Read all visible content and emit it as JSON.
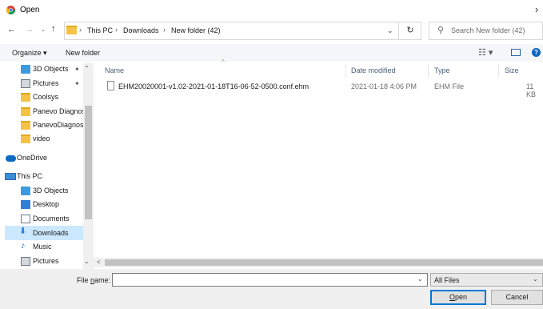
{
  "window": {
    "title": "Open"
  },
  "address": {
    "crumbs": [
      "This PC",
      "Downloads",
      "New folder (42)"
    ],
    "separator": "›",
    "search_placeholder": "Search New folder (42)"
  },
  "toolbar": {
    "organize_label": "Organize ▾",
    "new_folder_label": "New folder"
  },
  "nav": {
    "quick_access": [
      {
        "label": "3D Objects",
        "icon": "cube-icon",
        "pinned": true
      },
      {
        "label": "Pictures",
        "icon": "pictures-icon",
        "pinned": true
      },
      {
        "label": "Coolsys",
        "icon": "folder-icon"
      },
      {
        "label": "Panevo Diagnos",
        "icon": "folder-icon"
      },
      {
        "label": "PanevoDiagnost",
        "icon": "folder-icon"
      },
      {
        "label": "video",
        "icon": "folder-icon"
      }
    ],
    "onedrive": "OneDrive",
    "this_pc": "This PC",
    "pc_items": [
      {
        "label": "3D Objects",
        "icon": "cube-icon"
      },
      {
        "label": "Desktop",
        "icon": "desktop-icon"
      },
      {
        "label": "Documents",
        "icon": "documents-icon"
      },
      {
        "label": "Downloads",
        "icon": "downloads-icon",
        "selected": true
      },
      {
        "label": "Music",
        "icon": "music-icon"
      },
      {
        "label": "Pictures",
        "icon": "pictures-icon"
      }
    ]
  },
  "columns": {
    "name": "Name",
    "date": "Date modified",
    "type": "Type",
    "size": "Size"
  },
  "files": [
    {
      "name": "EHM20020001-v1.02-2021-01-18T16-06-52-0500.conf.ehm",
      "date": "2021-01-18 4:06 PM",
      "type": "EHM File",
      "size": "11 KB"
    }
  ],
  "bottom": {
    "filename_label_prefix": "File ",
    "filename_label_underlined": "n",
    "filename_label_suffix": "ame:",
    "filename_value": "",
    "filetype_value": "All Files",
    "open_label_underlined": "O",
    "open_label_rest": "pen",
    "cancel_label": "Cancel"
  },
  "colors": {
    "selection": "#cce8ff",
    "accent": "#0078d7",
    "header_text": "#4c607a"
  }
}
